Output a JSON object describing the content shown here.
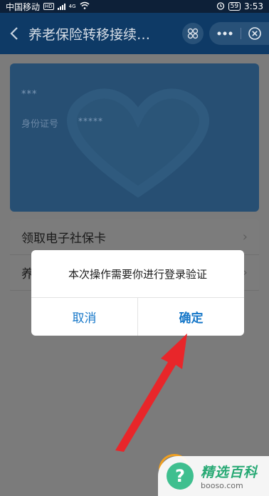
{
  "status_bar": {
    "carrier": "中国移动",
    "hd": "HD",
    "network": "4G",
    "battery": "59",
    "time": "3:53"
  },
  "nav": {
    "title": "养老保险转移接续…"
  },
  "card": {
    "name_masked": "***",
    "id_label": "身份证号",
    "id_masked": "*****"
  },
  "menu": {
    "items": [
      {
        "label": "领取电子社保卡"
      },
      {
        "label": "养"
      }
    ]
  },
  "dialog": {
    "message": "本次操作需要你进行登录验证",
    "cancel_label": "取消",
    "confirm_label": "确定"
  },
  "watermark": {
    "title": "精选百科",
    "url": "booso.com",
    "icon": "?"
  },
  "colors": {
    "nav_bg": "#0e3a66",
    "card_bg": "#274f73",
    "accent": "#1677c8",
    "arrow": "#e8262a",
    "watermark_green": "#27a974"
  }
}
